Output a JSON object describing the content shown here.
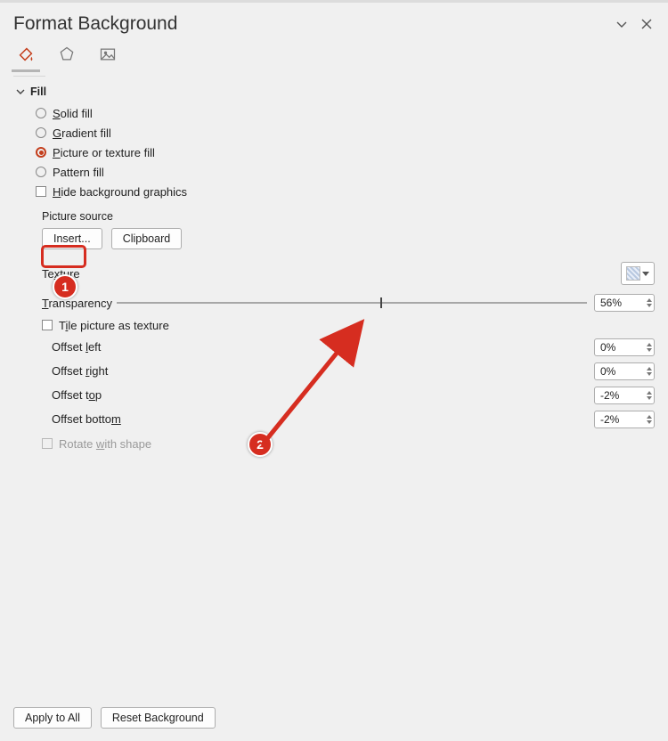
{
  "header": {
    "title": "Format Background"
  },
  "section": {
    "fill_label": "Fill"
  },
  "fill": {
    "solid": "olid fill",
    "solid_u": "S",
    "gradient": "radient fill",
    "gradient_u": "G",
    "picture": "icture or texture fill",
    "picture_u": "P",
    "pattern": "Pattern fill",
    "hide": "ide background graphics",
    "hide_u": "H"
  },
  "picture_source": {
    "label": "Picture source",
    "insert": "Insert...",
    "clipboard": "Clipboard"
  },
  "texture": {
    "label_pre": "Te",
    "label_u": "x",
    "label_post": "ture"
  },
  "transparency": {
    "label_pre": "",
    "label_u": "T",
    "label_post": "ransparency",
    "value": "56%",
    "percent": 56
  },
  "tile": {
    "label_pre": "T",
    "label_u": "i",
    "label_post": "le picture as texture"
  },
  "offsets": {
    "left_pre": "Offset ",
    "left_u": "l",
    "left_post": "eft",
    "left_val": "0%",
    "right_pre": "Offset ",
    "right_u": "r",
    "right_post": "ight",
    "right_val": "0%",
    "top_pre": "Offset t",
    "top_u": "o",
    "top_post": "p",
    "top_val": "-2%",
    "bottom_pre": "Offset botto",
    "bottom_u": "m",
    "bottom_post": "",
    "bottom_val": "-2%"
  },
  "rotate": {
    "pre": "Rotate ",
    "u": "w",
    "post": "ith shape"
  },
  "footer": {
    "apply": "Apply to All",
    "reset": "Reset Background"
  },
  "annotations": {
    "n1": "1",
    "n2": "2"
  }
}
